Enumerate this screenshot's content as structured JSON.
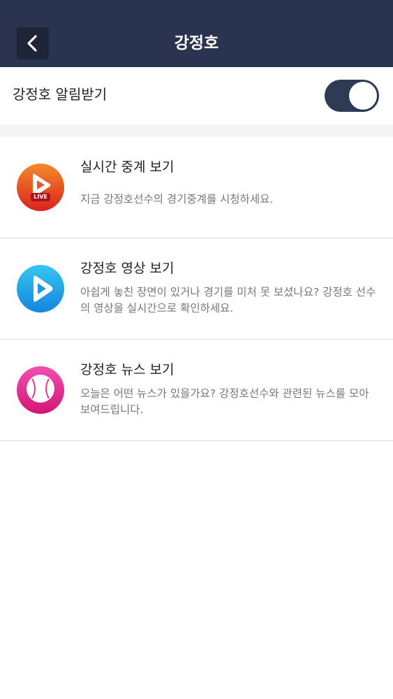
{
  "header": {
    "title": "강정호",
    "back_icon": "chevron-left-icon"
  },
  "notify": {
    "label": "강정호 알림받기",
    "toggle_on": true
  },
  "items": [
    {
      "title": "실시간 중계 보기",
      "description": "지금 강정호선수의 경기중계를 시청하세요.",
      "icon": "live-play-icon",
      "badge": "LIVE",
      "color": "#e8452a"
    },
    {
      "title": "강정호 영상 보기",
      "description": "아쉽게 놓친 장면이 있거나 경기를 미처 못 보셨나요? 강정호 선수의 영상을 실시간으로 확인하세요.",
      "icon": "video-play-icon",
      "color": "#1aa0e8"
    },
    {
      "title": "강정호 뉴스 보기",
      "description": "오늘은 어떤 뉴스가 있을가요? 강정호선수와 관련된 뉴스를 모아 보여드립니다.",
      "icon": "baseball-icon",
      "color": "#e82c8e"
    }
  ],
  "colors": {
    "header_bg": "#2a3450",
    "toggle_bg": "#2f3a54",
    "divider": "#dcdcdc"
  }
}
